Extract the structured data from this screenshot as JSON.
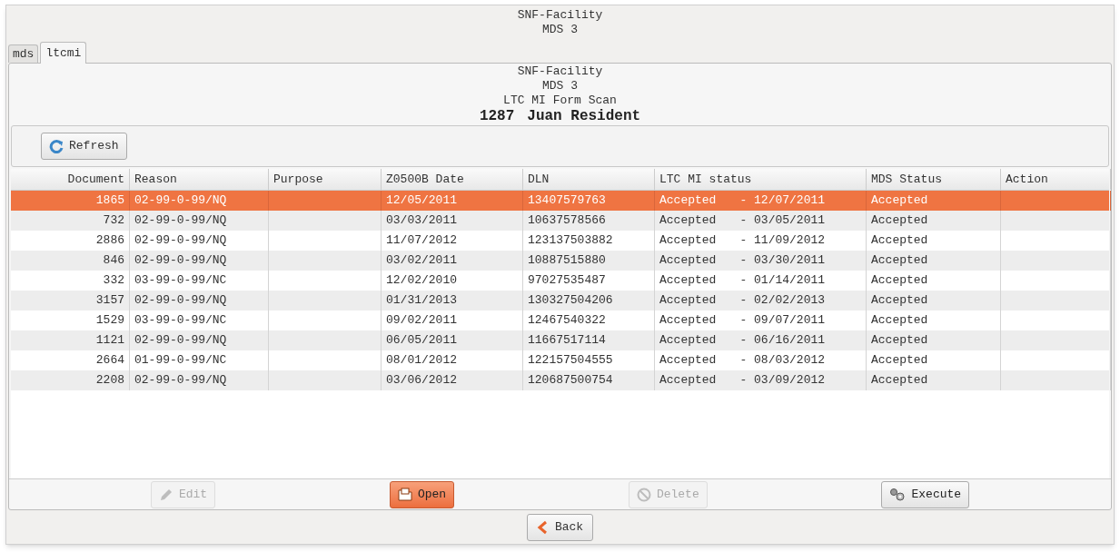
{
  "window": {
    "title_lines": [
      "SNF-Facility",
      "MDS 3"
    ]
  },
  "tabs": [
    {
      "label": "mds",
      "selected": false
    },
    {
      "label": "ltcmi",
      "selected": true
    }
  ],
  "header": {
    "lines": [
      "SNF-Facility",
      "MDS 3",
      "LTC MI Form Scan"
    ],
    "resident_id": "1287",
    "resident_name": "Juan Resident"
  },
  "toolbar": {
    "refresh": "Refresh"
  },
  "table": {
    "columns": [
      "Document",
      "Reason",
      "Purpose",
      "Z0500B Date",
      "DLN",
      "LTC MI status",
      "MDS Status",
      "Action"
    ],
    "rows": [
      {
        "document": "1865",
        "reason": "02-99-0-99/NQ",
        "z0500b_date": "12/05/2011",
        "dln": "13407579763",
        "ltc_status": "Accepted",
        "ltc_date": "- 12/07/2011",
        "mds_status": "Accepted",
        "selected": true
      },
      {
        "document": "732",
        "reason": "02-99-0-99/NQ",
        "z0500b_date": "03/03/2011",
        "dln": "10637578566",
        "ltc_status": "Accepted",
        "ltc_date": "- 03/05/2011",
        "mds_status": "Accepted",
        "selected": false
      },
      {
        "document": "2886",
        "reason": "02-99-0-99/NQ",
        "z0500b_date": "11/07/2012",
        "dln": "123137503882",
        "ltc_status": "Accepted",
        "ltc_date": "- 11/09/2012",
        "mds_status": "Accepted",
        "selected": false
      },
      {
        "document": "846",
        "reason": "02-99-0-99/NQ",
        "z0500b_date": "03/02/2011",
        "dln": "10887515880",
        "ltc_status": "Accepted",
        "ltc_date": "- 03/30/2011",
        "mds_status": "Accepted",
        "selected": false
      },
      {
        "document": "332",
        "reason": "03-99-0-99/NC",
        "z0500b_date": "12/02/2010",
        "dln": "97027535487",
        "ltc_status": "Accepted",
        "ltc_date": "- 01/14/2011",
        "mds_status": "Accepted",
        "selected": false
      },
      {
        "document": "3157",
        "reason": "02-99-0-99/NQ",
        "z0500b_date": "01/31/2013",
        "dln": "130327504206",
        "ltc_status": "Accepted",
        "ltc_date": "- 02/02/2013",
        "mds_status": "Accepted",
        "selected": false
      },
      {
        "document": "1529",
        "reason": "03-99-0-99/NC",
        "z0500b_date": "09/02/2011",
        "dln": "12467540322",
        "ltc_status": "Accepted",
        "ltc_date": "- 09/07/2011",
        "mds_status": "Accepted",
        "selected": false
      },
      {
        "document": "1121",
        "reason": "02-99-0-99/NQ",
        "z0500b_date": "06/05/2011",
        "dln": "11667517114",
        "ltc_status": "Accepted",
        "ltc_date": "- 06/16/2011",
        "mds_status": "Accepted",
        "selected": false
      },
      {
        "document": "2664",
        "reason": "01-99-0-99/NC",
        "z0500b_date": "08/01/2012",
        "dln": "122157504555",
        "ltc_status": "Accepted",
        "ltc_date": "- 08/03/2012",
        "mds_status": "Accepted",
        "selected": false
      },
      {
        "document": "2208",
        "reason": "02-99-0-99/NQ",
        "z0500b_date": "03/06/2012",
        "dln": "120687500754",
        "ltc_status": "Accepted",
        "ltc_date": "- 03/09/2012",
        "mds_status": "Accepted",
        "selected": false
      }
    ]
  },
  "actions": [
    {
      "kind": "edit",
      "label": "Edit",
      "disabled": true,
      "primary": false
    },
    {
      "kind": "open",
      "label": "Open",
      "disabled": false,
      "primary": true
    },
    {
      "kind": "delete",
      "label": "Delete",
      "disabled": true,
      "primary": false
    },
    {
      "kind": "execute",
      "label": "Execute",
      "disabled": false,
      "primary": false
    }
  ],
  "back": "Back"
}
